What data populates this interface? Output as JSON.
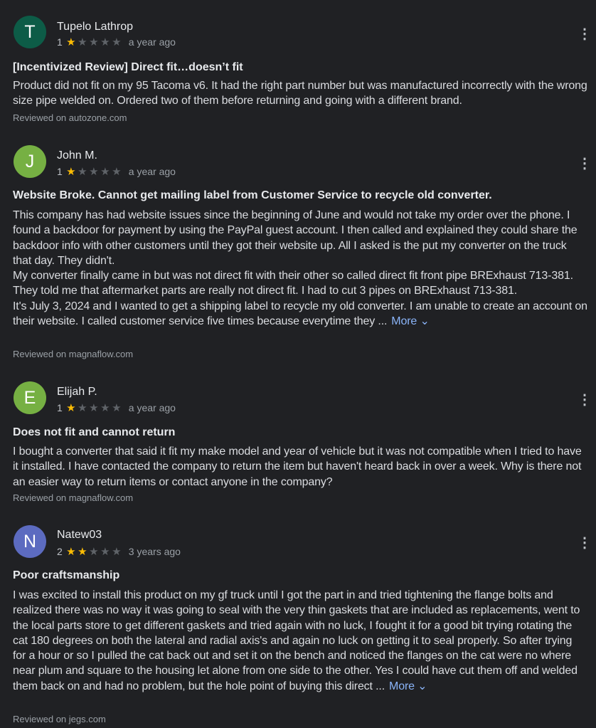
{
  "reviews": [
    {
      "initial": "T",
      "avatar_color": "#0d5c47",
      "name": "Tupelo Lathrop",
      "rating_text": "1",
      "stars": 1,
      "date": "a year ago",
      "menu_icon": "more-vert-icon",
      "title": "[Incentivized Review] Direct fit…doesn’t fit",
      "body": [
        "Product did not fit on my 95 Tacoma v6. It had the right part number but was manufactured incorrectly with the wrong size pipe welded on. Ordered two of them before returning and going with a different brand."
      ],
      "more": "",
      "source": "Reviewed on autozone.com"
    },
    {
      "initial": "J",
      "avatar_color": "#76b043",
      "name": "John M.",
      "rating_text": "1",
      "stars": 1,
      "date": "a year ago",
      "menu_icon": "more-vert-icon",
      "title": "Website Broke. Cannot get mailing label from Customer Service to recycle old converter.",
      "body": [
        "This company has had website issues since the beginning of June and would not take my order over the phone. I found a backdoor for payment by using the PayPal guest account. I then called and explained they could share the backdoor info with other customers until they got their website up. All I asked is the put my converter on the truck that day. They didn't.",
        "My converter finally came in but was not direct fit with their other so called direct fit front pipe BRExhaust 713-381. They told me that aftermarket parts are really not direct fit. I had to cut 3 pipes on BRExhaust 713-381.",
        "It's July 3, 2024 and I wanted to get a shipping label to recycle my old converter. I am unable to create an account on their website. I called customer service five times because everytime they ..."
      ],
      "more": "More ⌄",
      "source": "Reviewed on magnaflow.com"
    },
    {
      "initial": "E",
      "avatar_color": "#76b043",
      "name": "Elijah P.",
      "rating_text": "1",
      "stars": 1,
      "date": "a year ago",
      "menu_icon": "more-vert-icon",
      "title": "Does not fit and cannot return",
      "body": [
        "I bought a converter that said it fit my make model and year of vehicle but it was not compatible when I tried to have it installed. I have contacted the company to return the item but haven't heard back in over a week. Why is there not an easier way to return items or contact anyone in the company?"
      ],
      "more": "",
      "source": "Reviewed on magnaflow.com"
    },
    {
      "initial": "N",
      "avatar_color": "#5c6bc0",
      "name": "Natew03",
      "rating_text": "2",
      "stars": 2,
      "date": "3 years ago",
      "menu_icon": "more-vert-icon",
      "title": "Poor craftsmanship",
      "body": [
        "I was excited to install this product on my gf truck until I got the part in and tried tightening the flange bolts and realized there was no way it was going to seal with the very thin gaskets that are included as replacements, went to the local parts store to get different gaskets and tried again with no luck, I fought it for a good bit trying rotating the cat 180 degrees on both the lateral and radial axis's and again no luck on getting it to seal properly. So after trying for a hour or so I pulled the cat back out and set it on the bench and noticed the flanges on the cat were no where near plum and square to the housing let alone from one side to the other. Yes I could have cut them off and welded them back on and had no problem, but the hole point of buying this direct ..."
      ],
      "more": "More ⌄",
      "source": "Reviewed on jegs.com"
    }
  ]
}
